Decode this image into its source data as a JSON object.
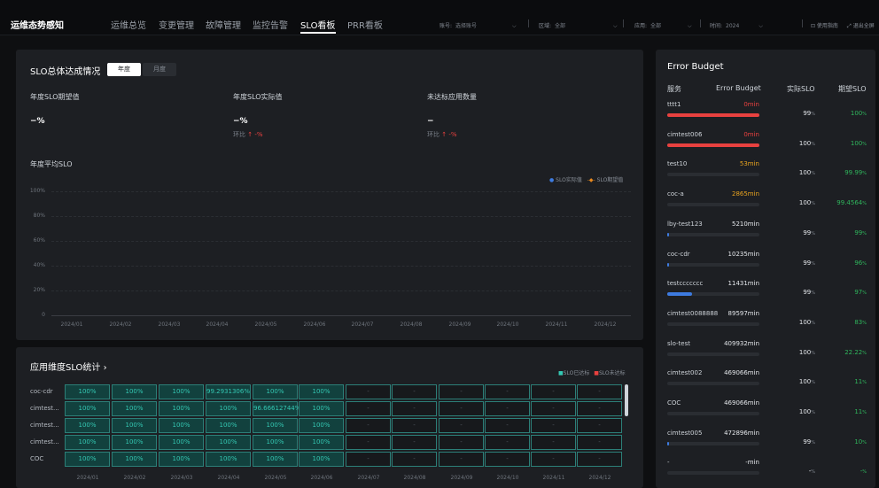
{
  "header": {
    "brand": "运维态势感知",
    "nav": [
      "运维总览",
      "变更管理",
      "故障管理",
      "监控告警",
      "SLO看板",
      "PRR看板"
    ],
    "filters": [
      {
        "label": "账号:",
        "value": "选择账号"
      },
      {
        "label": "区域:",
        "value": "全部"
      },
      {
        "label": "应用:",
        "value": "全部"
      },
      {
        "label": "时间:",
        "value": "2024"
      }
    ],
    "help": "⊡ 使用指南",
    "fullscreen": "⤢ 退出全屏"
  },
  "overall": {
    "title": "SLO总体达成情况",
    "tab_year": "年度",
    "tab_month": "月度",
    "expected_label": "年度SLO期望值",
    "expected_value": "−%",
    "actual_label": "年度SLO实际值",
    "actual_value": "−%",
    "actual_mom": "环比",
    "actual_mom_val": "↑ -%",
    "missed_label": "未达标应用数量",
    "missed_value": "−",
    "missed_mom": "环比",
    "missed_mom_val": "↑ -%",
    "chart_title": "年度平均SLO",
    "legend_actual": "SLO实际值",
    "legend_expected": "SLO期望值"
  },
  "chart_data": {
    "type": "line",
    "title": "年度平均SLO",
    "categories": [
      "2024/01",
      "2024/02",
      "2024/03",
      "2024/04",
      "2024/05",
      "2024/06",
      "2024/07",
      "2024/08",
      "2024/09",
      "2024/10",
      "2024/11",
      "2024/12"
    ],
    "yticks": [
      "100%",
      "80%",
      "60%",
      "40%",
      "20%",
      "0"
    ],
    "ylim": [
      0,
      100
    ],
    "series": [
      {
        "name": "SLO实际值",
        "values": [],
        "color": "#3d7be0"
      },
      {
        "name": "SLO期望值",
        "values": [],
        "color": "#e8891f"
      }
    ],
    "legend": "top-right",
    "grid": true
  },
  "app_stats": {
    "title": "应用维度SLO统计 ›",
    "legend_ok": "SLO已达标",
    "legend_miss": "SLO未达标",
    "months": [
      "2024/01",
      "2024/02",
      "2024/03",
      "2024/04",
      "2024/05",
      "2024/06",
      "2024/07",
      "2024/08",
      "2024/09",
      "2024/10",
      "2024/11",
      "2024/12"
    ],
    "rows": [
      {
        "name": "coc-cdr",
        "cells": [
          "100%",
          "100%",
          "100%",
          "99.2931306%",
          "100%",
          "100%",
          "-",
          "-",
          "-",
          "-",
          "-",
          "-"
        ]
      },
      {
        "name": "cimtest...",
        "cells": [
          "100%",
          "100%",
          "100%",
          "100%",
          "96.66612744%",
          "100%",
          "-",
          "-",
          "-",
          "-",
          "-",
          "-"
        ]
      },
      {
        "name": "cimtest...",
        "cells": [
          "100%",
          "100%",
          "100%",
          "100%",
          "100%",
          "100%",
          "-",
          "-",
          "-",
          "-",
          "-",
          "-"
        ]
      },
      {
        "name": "cimtest...",
        "cells": [
          "100%",
          "100%",
          "100%",
          "100%",
          "100%",
          "100%",
          "-",
          "-",
          "-",
          "-",
          "-",
          "-"
        ]
      },
      {
        "name": "COC",
        "cells": [
          "100%",
          "100%",
          "100%",
          "100%",
          "100%",
          "100%",
          "-",
          "-",
          "-",
          "-",
          "-",
          "-"
        ]
      }
    ]
  },
  "error_budget": {
    "title": "Error Budget",
    "col_service": "服务",
    "col_budget": "Error Budget",
    "col_actual": "实际SLO",
    "col_expected": "期望SLO",
    "rows": [
      {
        "name": "tttt1",
        "budget": "0min",
        "budget_color": "#e8413f",
        "fill": 1.0,
        "fill_color": "#e8413f",
        "actual": "99",
        "expected": "100",
        "exp_color": "#2fb55c"
      },
      {
        "name": "cimtest006",
        "budget": "0min",
        "budget_color": "#e8413f",
        "fill": 1.0,
        "fill_color": "#e8413f",
        "actual": "100",
        "expected": "100",
        "exp_color": "#2fb55c"
      },
      {
        "name": "test10",
        "budget": "53min",
        "budget_color": "#e8a31f",
        "fill": 0.0,
        "fill_color": "#3d7be0",
        "actual": "100",
        "expected": "99.99",
        "exp_color": "#2fb55c"
      },
      {
        "name": "coc-a",
        "budget": "2865min",
        "budget_color": "#e8a31f",
        "fill": 0.0,
        "fill_color": "#3d7be0",
        "actual": "100",
        "expected": "99.4564",
        "exp_color": "#2fb55c"
      },
      {
        "name": "lby-test123",
        "budget": "5210min",
        "budget_color": "#e3e6ea",
        "fill": 0.01,
        "fill_color": "#3d7be0",
        "actual": "99",
        "expected": "99",
        "exp_color": "#2fb55c"
      },
      {
        "name": "coc-cdr",
        "budget": "10235min",
        "budget_color": "#e3e6ea",
        "fill": 0.02,
        "fill_color": "#3d7be0",
        "actual": "99",
        "expected": "96",
        "exp_color": "#2fb55c"
      },
      {
        "name": "testccccccc",
        "budget": "11431min",
        "budget_color": "#e3e6ea",
        "fill": 0.27,
        "fill_color": "#3d7be0",
        "actual": "99",
        "expected": "97",
        "exp_color": "#2fb55c"
      },
      {
        "name": "cimtest0088888",
        "budget": "89597min",
        "budget_color": "#e3e6ea",
        "fill": 0.0,
        "fill_color": "#3d7be0",
        "actual": "100",
        "expected": "83",
        "exp_color": "#2fb55c"
      },
      {
        "name": "slo-test",
        "budget": "409932min",
        "budget_color": "#e3e6ea",
        "fill": 0.0,
        "fill_color": "#3d7be0",
        "actual": "100",
        "expected": "22.22",
        "exp_color": "#2fb55c"
      },
      {
        "name": "cimtest002",
        "budget": "469066min",
        "budget_color": "#e3e6ea",
        "fill": 0.0,
        "fill_color": "#3d7be0",
        "actual": "100",
        "expected": "11",
        "exp_color": "#2fb55c"
      },
      {
        "name": "COC",
        "budget": "469066min",
        "budget_color": "#e3e6ea",
        "fill": 0.0,
        "fill_color": "#3d7be0",
        "actual": "100",
        "expected": "11",
        "exp_color": "#2fb55c"
      },
      {
        "name": "cimtest005",
        "budget": "472896min",
        "budget_color": "#e3e6ea",
        "fill": 0.01,
        "fill_color": "#3d7be0",
        "actual": "99",
        "expected": "10",
        "exp_color": "#2fb55c"
      },
      {
        "name": "-",
        "budget": "-min",
        "budget_color": "#e3e6ea",
        "fill": 0.0,
        "fill_color": "#3d7be0",
        "actual": "-",
        "expected": "-",
        "exp_color": "#2fb55c"
      }
    ]
  }
}
